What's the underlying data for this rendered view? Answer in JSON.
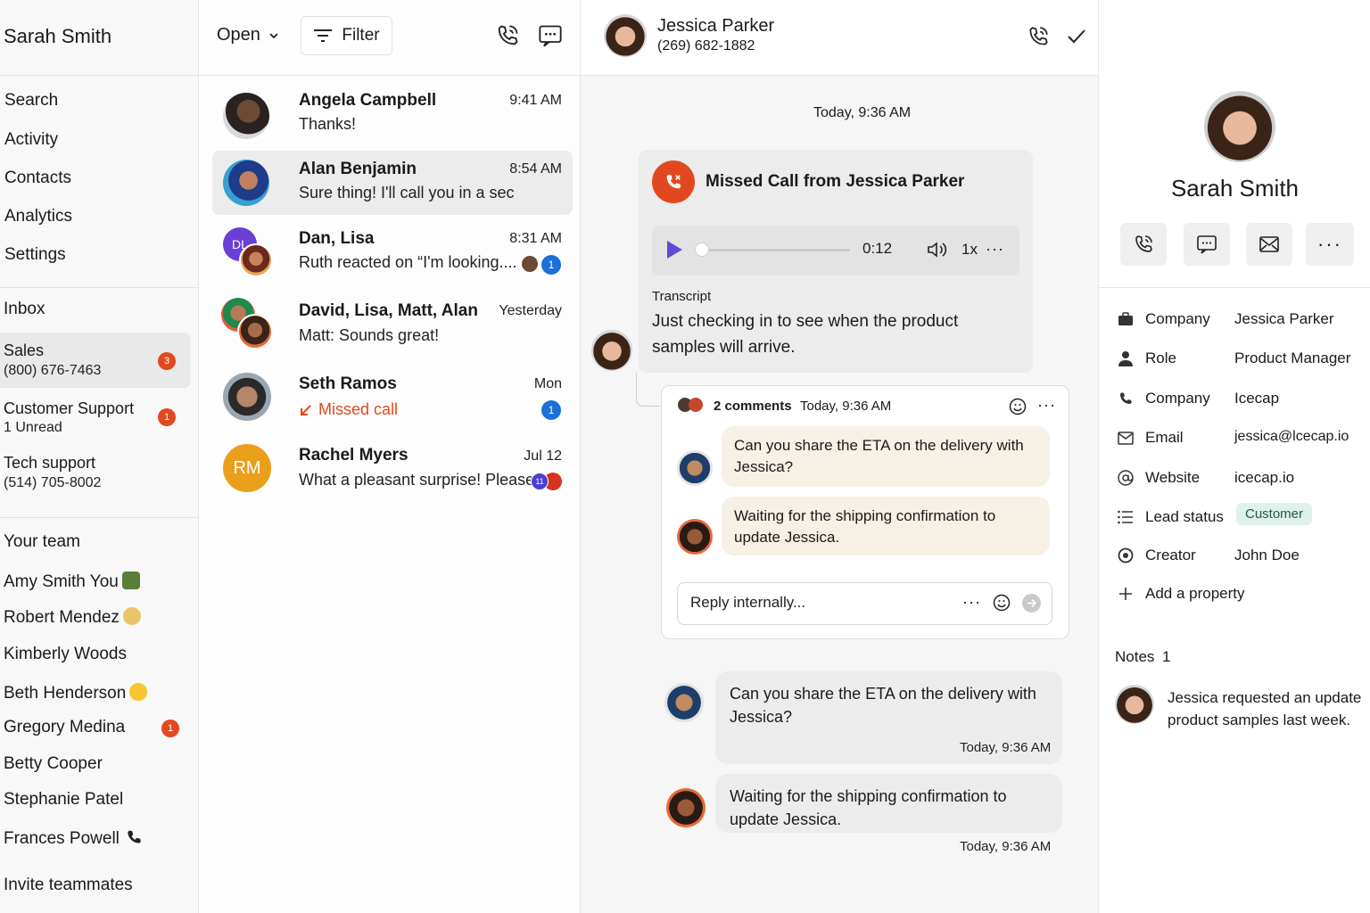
{
  "sidebar": {
    "user_name": "Sarah Smith",
    "nav": [
      "Search",
      "Activity",
      "Contacts",
      "Analytics",
      "Settings"
    ],
    "inbox_heading": "Inbox",
    "inboxes": [
      {
        "name": "Sales",
        "sub": "(800) 676-7463",
        "badge": "3"
      },
      {
        "name": "Customer Support",
        "sub": "1 Unread",
        "badge": "1"
      },
      {
        "name": "Tech support",
        "sub": "(514) 705-8002",
        "badge": ""
      }
    ],
    "team_heading": "Your team",
    "team": [
      {
        "name": "Amy Smith You",
        "status_icon": "desk-icon"
      },
      {
        "name": "Robert Mendez",
        "status_icon": "island-icon"
      },
      {
        "name": "Kimberly Woods",
        "status_icon": ""
      },
      {
        "name": "Beth Henderson",
        "status_icon": "smile-emoji-icon"
      },
      {
        "name": "Gregory Medina",
        "badge": "1"
      },
      {
        "name": "Betty Cooper",
        "status_icon": ""
      },
      {
        "name": "Stephanie Patel",
        "status_icon": ""
      },
      {
        "name": "Frances Powell",
        "status_icon": "phone-icon"
      }
    ],
    "invite": "Invite teammates"
  },
  "convlist": {
    "status_dropdown": "Open",
    "filter_label": "Filter",
    "items": [
      {
        "name": "Angela Campbell",
        "time": "9:41 AM",
        "preview": "Thanks!"
      },
      {
        "name": "Alan Benjamin",
        "time": "8:54 AM",
        "preview": "Sure thing! I'll call you in a sec"
      },
      {
        "name": "Dan, Lisa",
        "time": "8:31 AM",
        "preview": "Ruth reacted on “I'm looking....",
        "initials": "DL",
        "unread": "1"
      },
      {
        "name": "David, Lisa, Matt, Alan",
        "time": "Yesterday",
        "preview": "Matt: Sounds great!"
      },
      {
        "name": "Seth Ramos",
        "time": "Mon",
        "preview": "Missed call",
        "unread": "1"
      },
      {
        "name": "Rachel Myers",
        "time": "Jul 12",
        "preview": "What a pleasant surprise! Please...",
        "initials": "RM",
        "count": "11"
      }
    ]
  },
  "chat": {
    "contact_name": "Jessica Parker",
    "contact_phone": "(269) 682-1882",
    "date_stamp": "Today, 9:36 AM",
    "missed_call_title": "Missed Call from Jessica Parker",
    "audio": {
      "time": "0:12",
      "speed": "1x",
      "progress": 0
    },
    "transcript_label": "Transcript",
    "transcript_text": "Just checking in to see when the product samples will arrive.",
    "comments": {
      "count_label": "2 comments",
      "time": "Today, 9:36 AM",
      "items": [
        "Can you share the ETA on the delivery with Jessica?",
        "Waiting for the shipping confirmation to update Jessica."
      ],
      "reply_placeholder": "Reply internally..."
    },
    "messages": [
      {
        "text": "Can you share the ETA on the delivery with Jessica?",
        "time": "Today, 9:36 AM"
      },
      {
        "text": "Waiting for the shipping confirmation to update Jessica.",
        "time": "Today, 9:36 AM"
      }
    ]
  },
  "contact": {
    "name": "Sarah Smith",
    "properties": [
      {
        "icon": "briefcase-icon",
        "label": "Company",
        "value": "Jessica Parker"
      },
      {
        "icon": "person-icon",
        "label": "Role",
        "value": "Product Manager"
      },
      {
        "icon": "phone-icon",
        "label": "Company",
        "value": "Icecap"
      },
      {
        "icon": "mail-icon",
        "label": "Email",
        "value": "jessica@lcecap.io"
      },
      {
        "icon": "at-icon",
        "label": "Website",
        "value": "icecap.io"
      },
      {
        "icon": "list-icon",
        "label": "Lead status",
        "value": "Customer"
      },
      {
        "icon": "target-icon",
        "label": "Creator",
        "value": "John Doe"
      }
    ],
    "add_property": "Add a property",
    "notes_label": "Notes",
    "notes_count": "1",
    "note_text": "Jessica requested an update product samples last week."
  },
  "colors": {
    "accent_orange": "#e2481f",
    "blue": "#1a6fd8",
    "play": "#5b4bd6",
    "lead_status_bg": "#dff1ec"
  }
}
